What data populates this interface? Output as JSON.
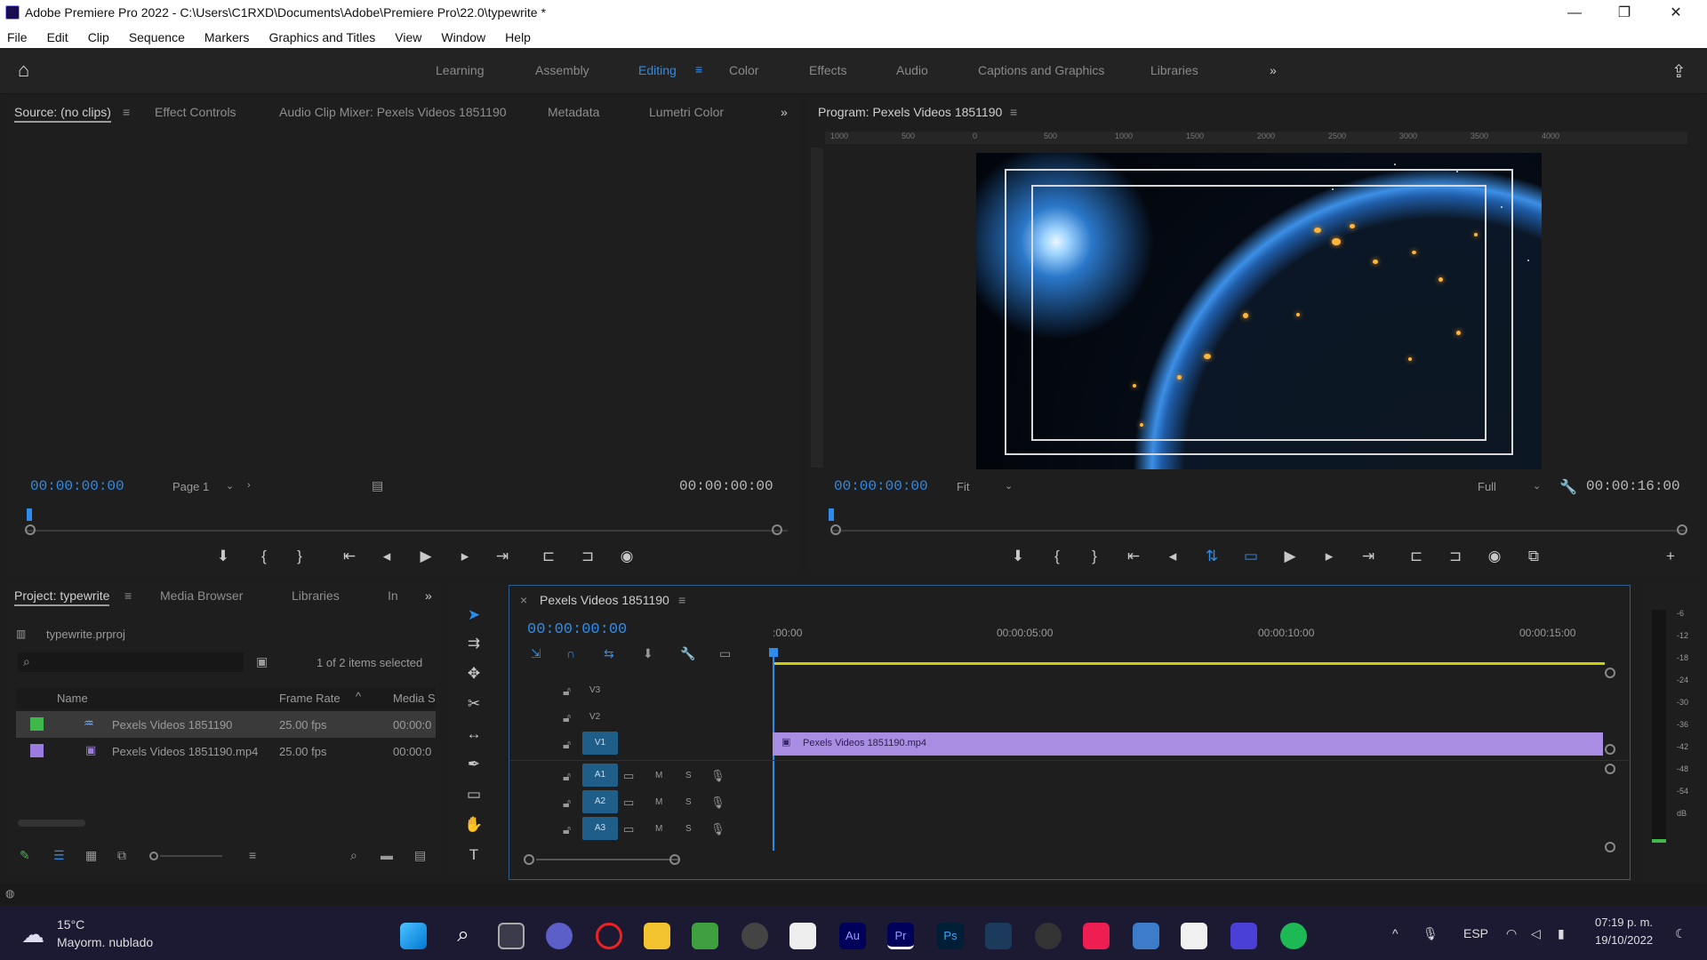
{
  "window": {
    "title": "Adobe Premiere Pro 2022 - C:\\Users\\C1RXD\\Documents\\Adobe\\Premiere Pro\\22.0\\typewrite *",
    "minimize": "—",
    "maximize": "❐",
    "close": "✕"
  },
  "menu": [
    "File",
    "Edit",
    "Clip",
    "Sequence",
    "Markers",
    "Graphics and Titles",
    "View",
    "Window",
    "Help"
  ],
  "workspaces": {
    "items": [
      "Learning",
      "Assembly",
      "Editing",
      "Color",
      "Effects",
      "Audio",
      "Captions and Graphics",
      "Libraries"
    ],
    "active": "Editing",
    "more": "»"
  },
  "source_panel": {
    "tabs": [
      "Source: (no clips)",
      "Effect Controls",
      "Audio Clip Mixer: Pexels Videos 1851190",
      "Metadata",
      "Lumetri Color"
    ],
    "timecode_left": "00:00:00:00",
    "page": "Page 1",
    "timecode_right": "00:00:00:00"
  },
  "program_panel": {
    "title": "Program: Pexels Videos 1851190",
    "timecode_left": "00:00:00:00",
    "fit": "Fit",
    "quality": "Full",
    "timecode_right": "00:00:16:00",
    "ruler_labels": [
      "1000",
      "500",
      "0",
      "500",
      "1000",
      "1500",
      "2000",
      "2500",
      "3000",
      "3500",
      "4000"
    ]
  },
  "project_panel": {
    "tabs": [
      "Project: typewrite",
      "Media Browser",
      "Libraries",
      "In"
    ],
    "project_file": "typewrite.prproj",
    "items_selected": "1 of 2 items selected",
    "columns": [
      "Name",
      "Frame Rate",
      "Media S"
    ],
    "rows": [
      {
        "name": "Pexels Videos 1851190",
        "rate": "25.00 fps",
        "media": "00:00:0",
        "color": "#3fb84a",
        "selected": true
      },
      {
        "name": "Pexels Videos 1851190.mp4",
        "rate": "25.00 fps",
        "media": "00:00:0",
        "color": "#9a7be0",
        "selected": false
      }
    ]
  },
  "timeline": {
    "title": "Pexels Videos 1851190",
    "timecode": "00:00:00:00",
    "ruler": [
      ":00:00",
      "00:00:05:00",
      "00:00:10:00",
      "00:00:15:00"
    ],
    "video_tracks": [
      "V3",
      "V2",
      "V1"
    ],
    "audio_tracks": [
      "A1",
      "A2",
      "A3"
    ],
    "audio_btns": [
      "M",
      "S"
    ],
    "clip": "Pexels Videos 1851190.mp4"
  },
  "audio_meter": {
    "labels": [
      "-6",
      "-12",
      "-18",
      "-24",
      "-30",
      "-36",
      "-42",
      "-48",
      "-54",
      "dB"
    ]
  },
  "taskbar": {
    "temp": "15°C",
    "weather": "Mayorm. nublado",
    "lang": "ESP",
    "time": "07:19 p. m.",
    "date": "19/10/2022"
  },
  "colors": {
    "accent": "#2d8ceb",
    "clip": "#a98de3",
    "track_btn": "#1f5e88",
    "work_area": "#d0d000"
  }
}
